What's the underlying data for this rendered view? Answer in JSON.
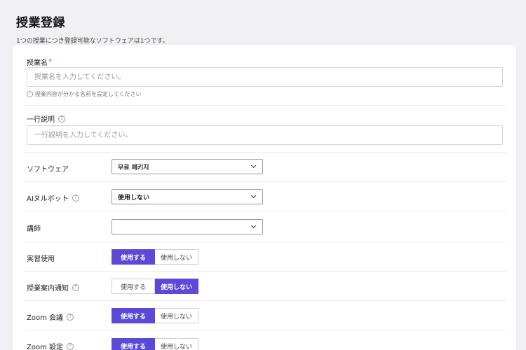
{
  "header": {
    "title": "授業登録",
    "subtitle": "1つの授業につき登録可能なソフトウェアは1つです。"
  },
  "form": {
    "class_name": {
      "label": "授業名",
      "required_mark": "*",
      "placeholder": "授業名を入力してください。",
      "hint": "授業内容が分かる名前を設定してください"
    },
    "description": {
      "label": "一行説明",
      "placeholder": "一行説明を入力してください。"
    },
    "software": {
      "label": "ソフトウェア",
      "selected": "무료 패키지"
    },
    "ai_bot": {
      "label": "AIヌルボット",
      "selected": "使用しない"
    },
    "instructor": {
      "label": "講師",
      "selected": ""
    },
    "practice": {
      "label": "実習使用",
      "active": "use"
    },
    "class_notice": {
      "label": "授業案内通知",
      "active": "not_use"
    },
    "zoom_meeting": {
      "label": "Zoom 会議",
      "active": "use"
    },
    "zoom_settings": {
      "label": "Zoom 設定",
      "active": "use"
    },
    "toggle_labels": {
      "use": "使用する",
      "not_use": "使用しない"
    }
  },
  "icons": {
    "help": "?",
    "info": "!"
  },
  "colors": {
    "accent": "#5b4ad8",
    "required": "#e53935"
  }
}
